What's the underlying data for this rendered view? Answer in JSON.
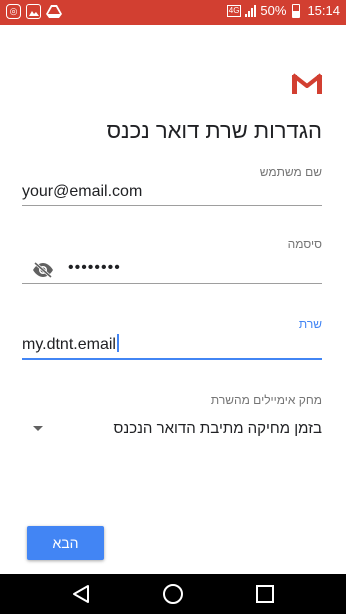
{
  "status_bar": {
    "battery": "50%",
    "time": "15:14",
    "network": "4G",
    "battery_level": 0.5
  },
  "header": {
    "title": "הגדרות שרת דואר נכנס"
  },
  "form": {
    "username": {
      "label": "שם משתמש",
      "value": "your@email.com"
    },
    "password": {
      "label": "סיסמה",
      "value": "••••••••"
    },
    "server": {
      "label": "שרת",
      "value": "my.dtnt.email"
    },
    "delete_policy": {
      "label": "מחק אימיילים מהשרת",
      "value": "בזמן מחיקה מתיבת הדואר הנכנס"
    }
  },
  "actions": {
    "next_label": "הבא"
  },
  "colors": {
    "status_bar": "#d23f31",
    "accent": "#4285f4",
    "nav_bar": "#000000"
  },
  "icons": {
    "status_left": [
      "cast-icon",
      "image-icon",
      "drive-icon"
    ],
    "eye": "visibility-off-icon",
    "nav": [
      "back-icon",
      "home-icon",
      "recents-icon"
    ]
  }
}
